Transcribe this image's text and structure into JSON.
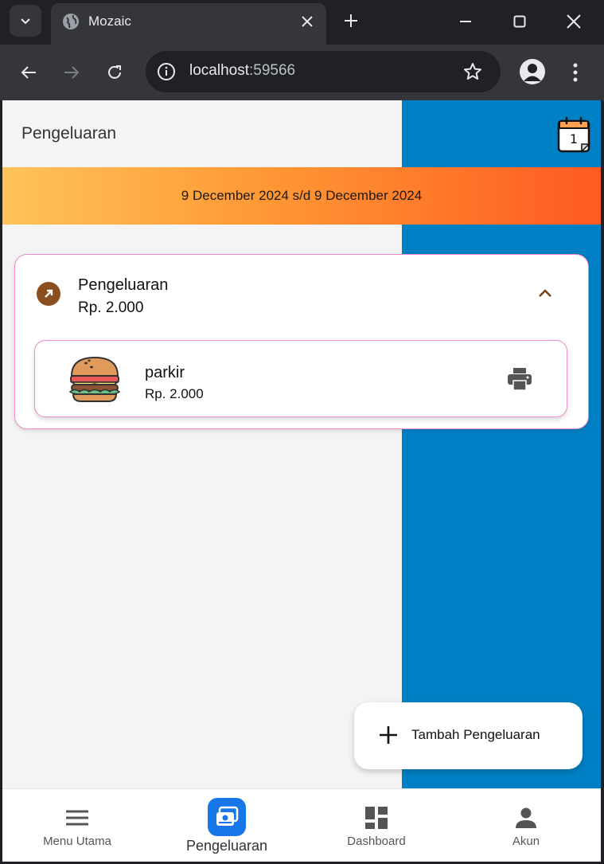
{
  "browser": {
    "tab_title": "Mozaic",
    "url_host": "localhost",
    "url_port": ":59566"
  },
  "page": {
    "title": "Pengeluaran",
    "calendar_day": "1",
    "date_range": "9 December 2024 s/d 9 December 2024"
  },
  "expense_group": {
    "title": "Pengeluaran",
    "amount": "Rp. 2.000",
    "items": [
      {
        "name": "parkir",
        "amount": "Rp. 2.000",
        "icon": "burger-icon"
      }
    ]
  },
  "fab": {
    "label": "Tambah Pengeluaran"
  },
  "bottom_nav": {
    "items": [
      {
        "label": "Menu Utama",
        "icon": "menu-icon"
      },
      {
        "label": "Pengeluaran",
        "icon": "wallet-icon",
        "active": true
      },
      {
        "label": "Dashboard",
        "icon": "dashboard-icon"
      },
      {
        "label": "Akun",
        "icon": "person-icon"
      }
    ]
  },
  "colors": {
    "panel_blue": "#0080c4",
    "banner_start": "#ffc35a",
    "banner_end": "#ff5a22",
    "card_border": "#f08bc8",
    "category_brown": "#8a4e1f",
    "nav_active": "#1877e8"
  }
}
